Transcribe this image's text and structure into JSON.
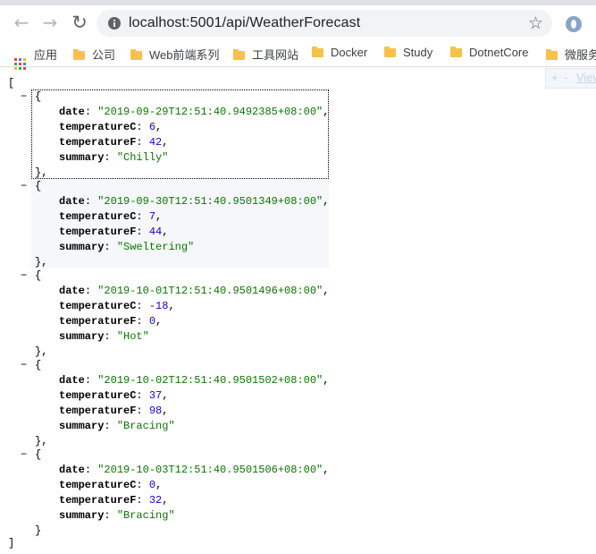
{
  "browser": {
    "url": "localhost:5001/api/WeatherForecast"
  },
  "bookmarks": {
    "items": [
      {
        "label": "应用",
        "icon": "apps-grid-icon"
      },
      {
        "label": "公司",
        "icon": "folder-icon"
      },
      {
        "label": "Web前端系列",
        "icon": "folder-icon"
      },
      {
        "label": "工具网站",
        "icon": "folder-icon"
      },
      {
        "label": "Docker",
        "icon": "folder-icon"
      },
      {
        "label": "Study",
        "icon": "folder-icon"
      },
      {
        "label": "DotnetCore",
        "icon": "folder-icon"
      },
      {
        "label": "微服务",
        "icon": "folder-icon"
      }
    ]
  },
  "jsonview": {
    "expand": "+",
    "collapse": "-",
    "view": "View"
  },
  "json": {
    "open_bracket": "[",
    "close_bracket": "]",
    "keys": {
      "date": "date",
      "temperatureC": "temperatureC",
      "temperatureF": "temperatureF",
      "summary": "summary"
    },
    "items": [
      {
        "date": "\"2019-09-29T12:51:40.9492385+08:00\"",
        "temperatureC": "6",
        "temperatureF": "42",
        "summary": "\"Chilly\""
      },
      {
        "date": "\"2019-09-30T12:51:40.9501349+08:00\"",
        "temperatureC": "7",
        "temperatureF": "44",
        "summary": "\"Sweltering\""
      },
      {
        "date": "\"2019-10-01T12:51:40.9501496+08:00\"",
        "temperatureC": "-18",
        "temperatureF": "0",
        "summary": "\"Hot\""
      },
      {
        "date": "\"2019-10-02T12:51:40.9501502+08:00\"",
        "temperatureC": "37",
        "temperatureF": "98",
        "summary": "\"Bracing\""
      },
      {
        "date": "\"2019-10-03T12:51:40.9501506+08:00\"",
        "temperatureC": "0",
        "temperatureF": "32",
        "summary": "\"Bracing\""
      }
    ]
  }
}
